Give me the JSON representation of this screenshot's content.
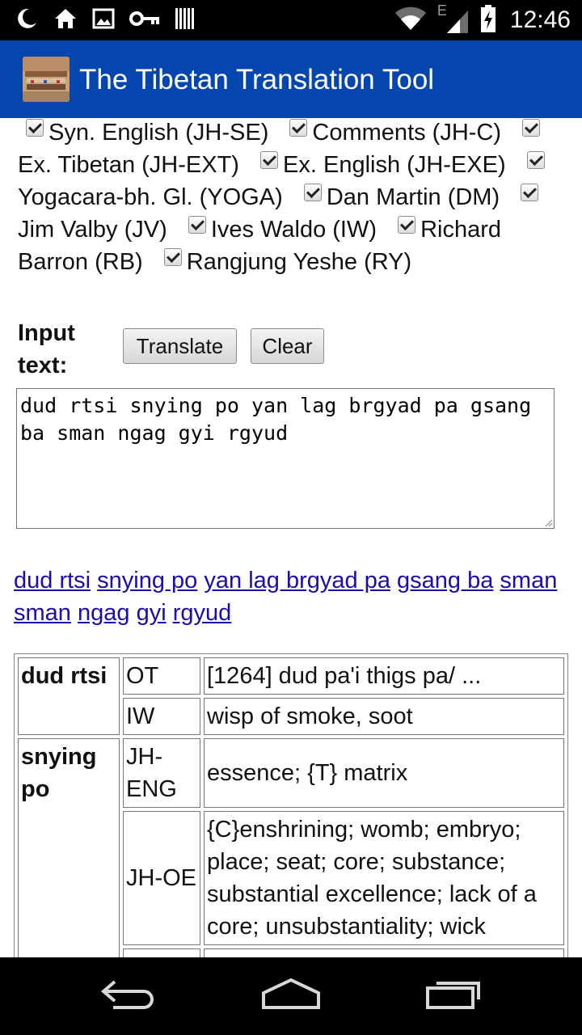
{
  "status_bar": {
    "time": "12:46",
    "left_icons": [
      "moon-icon",
      "home-icon",
      "image-icon",
      "key-icon",
      "barcode-icon"
    ],
    "right_icons": [
      "wifi-icon",
      "signal-icon",
      "battery-charging-icon"
    ],
    "network_label": "E"
  },
  "app_bar": {
    "title": "The Tibetan Translation Tool"
  },
  "sources": [
    {
      "label": "Syn. English (JH-SE)",
      "checked": true
    },
    {
      "label": "Comments (JH-C)",
      "checked": true
    },
    {
      "label": "Ex. Tibetan (JH-EXT)",
      "checked": true
    },
    {
      "label": "Ex. English (JH-EXE)",
      "checked": true
    },
    {
      "label": "Yogacara-bh. Gl. (YOGA)",
      "checked": true
    },
    {
      "label": "Dan Martin (DM)",
      "checked": true
    },
    {
      "label": "Jim Valby (JV)",
      "checked": true
    },
    {
      "label": "Ives Waldo (IW)",
      "checked": true
    },
    {
      "label": "Richard Barron (RB)",
      "checked": true
    },
    {
      "label": "Rangjung Yeshe (RY)",
      "checked": true
    }
  ],
  "input": {
    "label": "Input text:",
    "translate_button": "Translate",
    "clear_button": "Clear",
    "text": "dud rtsi snying po yan lag brgyad pa gsang ba sman ngag gyi rgyud"
  },
  "word_links": [
    "dud rtsi",
    "snying po",
    "yan lag brgyad pa",
    "gsang ba",
    "sman",
    "sman",
    "ngag",
    "gyi",
    "rgyud"
  ],
  "results": [
    {
      "term": "dud rtsi",
      "entries": [
        {
          "source": "OT",
          "definition": "[1264] dud pa'i thigs pa/ ..."
        },
        {
          "source": "IW",
          "definition": "wisp of smoke, soot"
        }
      ]
    },
    {
      "term": "snying po",
      "entries": [
        {
          "source": "JH-ENG",
          "definition": "essence; {T} matrix"
        },
        {
          "source": "JH-OE",
          "definition": "{C}enshrining; womb; embryo; place; seat; core; substance; substantial excellence; lack of a core; unsubstantiality; wick"
        }
      ]
    }
  ],
  "nav_bar": {
    "icons": [
      "back-icon",
      "home-icon",
      "recents-icon"
    ]
  }
}
